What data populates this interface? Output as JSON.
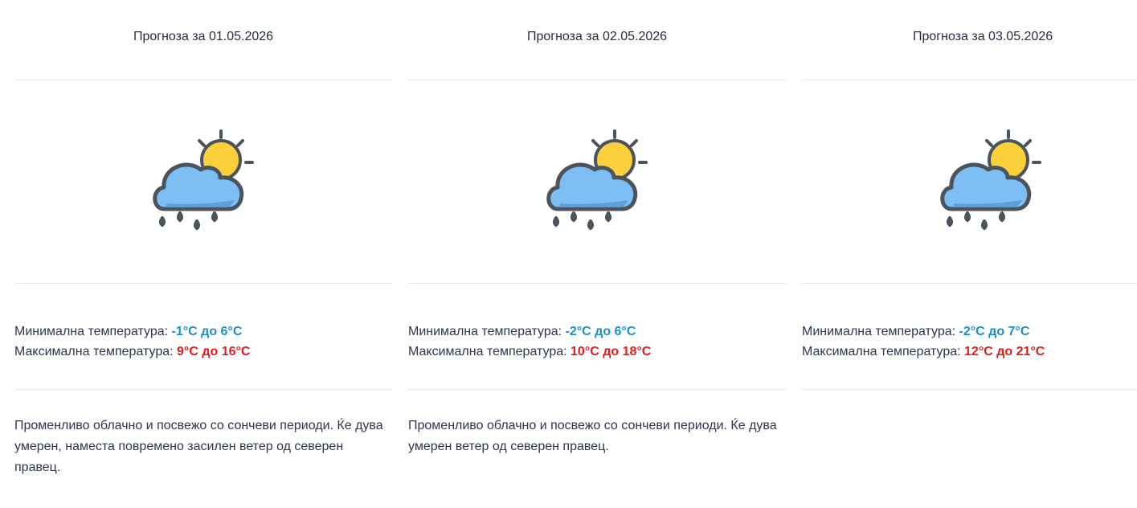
{
  "forecasts": [
    {
      "title": "Прогноза за 01.05.2026",
      "min_label": "Минимална температура: ",
      "min_value": "-1°C до 6°C",
      "max_label": "Максимална температура: ",
      "max_value": "9°C до 16°C",
      "description": "Променливо облачно и посвежо со сончеви периоди. Ќе дува умерен, наместа повремено засилен ветер од северен правец."
    },
    {
      "title": "Прогноза за 02.05.2026",
      "min_label": "Минимална температура: ",
      "min_value": "-2°C до 6°C",
      "max_label": "Максимална температура: ",
      "max_value": "10°C до 18°C",
      "description": "Променливо облачно и посвежо со сончеви периоди. Ќе дува умерен ветер од северен правец."
    },
    {
      "title": "Прогноза за 03.05.2026",
      "min_label": "Минимална температура: ",
      "min_value": "-2°C до 7°C",
      "max_label": "Максимална температура: ",
      "max_value": "12°C до 21°C",
      "description": ""
    }
  ],
  "icon": "sun-cloud-rain-icon",
  "colors": {
    "min_temp": "#1a8fc9",
    "max_temp": "#e21b1b",
    "cloud": "#7dbff5",
    "sun": "#fcd03a",
    "outline": "#4b545c"
  }
}
